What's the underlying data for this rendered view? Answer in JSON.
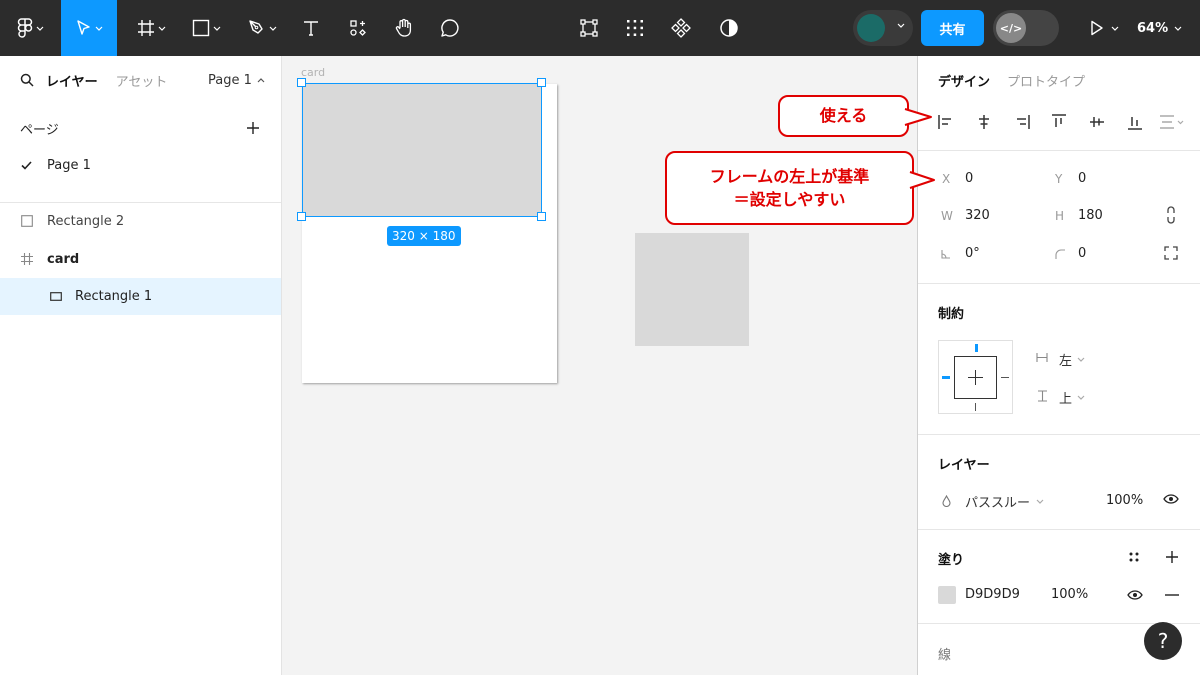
{
  "toolbar": {
    "share_label": "共有",
    "dev_mode_label": "</>",
    "zoom_label": "64%",
    "tools": [
      "main-menu",
      "move",
      "frame",
      "shape",
      "pen",
      "text",
      "resources",
      "hand",
      "comment"
    ],
    "center_tools": [
      "mask",
      "component-grid",
      "component",
      "contrast"
    ]
  },
  "left_panel": {
    "tab_layers": "レイヤー",
    "tab_assets": "アセット",
    "page_selector": "Page 1",
    "pages_heading": "ページ",
    "pages": [
      {
        "label": "Page 1",
        "current": true
      }
    ],
    "layers": [
      {
        "label": "Rectangle 2",
        "type": "rectangle",
        "indent": 0,
        "selected": false
      },
      {
        "label": "card",
        "type": "frame",
        "indent": 0,
        "selected": false
      },
      {
        "label": "Rectangle 1",
        "type": "rectangle",
        "indent": 1,
        "selected": true
      }
    ]
  },
  "canvas": {
    "frame_label": "card",
    "selection_size": "320 × 180"
  },
  "right_panel": {
    "tab_design": "デザイン",
    "tab_prototype": "プロトタイプ",
    "x_label": "X",
    "x_value": "0",
    "y_label": "Y",
    "y_value": "0",
    "w_label": "W",
    "w_value": "320",
    "h_label": "H",
    "h_value": "180",
    "rotation_value": "0°",
    "radius_value": "0",
    "constraints_heading": "制約",
    "constraint_h": "左",
    "constraint_v": "上",
    "layer_heading": "レイヤー",
    "blend_mode": "パススルー",
    "layer_opacity": "100%",
    "fill_heading": "塗り",
    "fill_hex": "D9D9D9",
    "fill_opacity": "100%",
    "stroke_heading": "線"
  },
  "callouts": {
    "usable": "使える",
    "frame_origin_line1": "フレームの左上が基準",
    "frame_origin_line2": "＝設定しやすい"
  },
  "help_label": "?",
  "colors": {
    "accent": "#0d99ff",
    "toolbar_bg": "#2c2c2c",
    "callout_red": "#e00000",
    "fill": "#d9d9d9",
    "avatar": "#1b6b67"
  }
}
